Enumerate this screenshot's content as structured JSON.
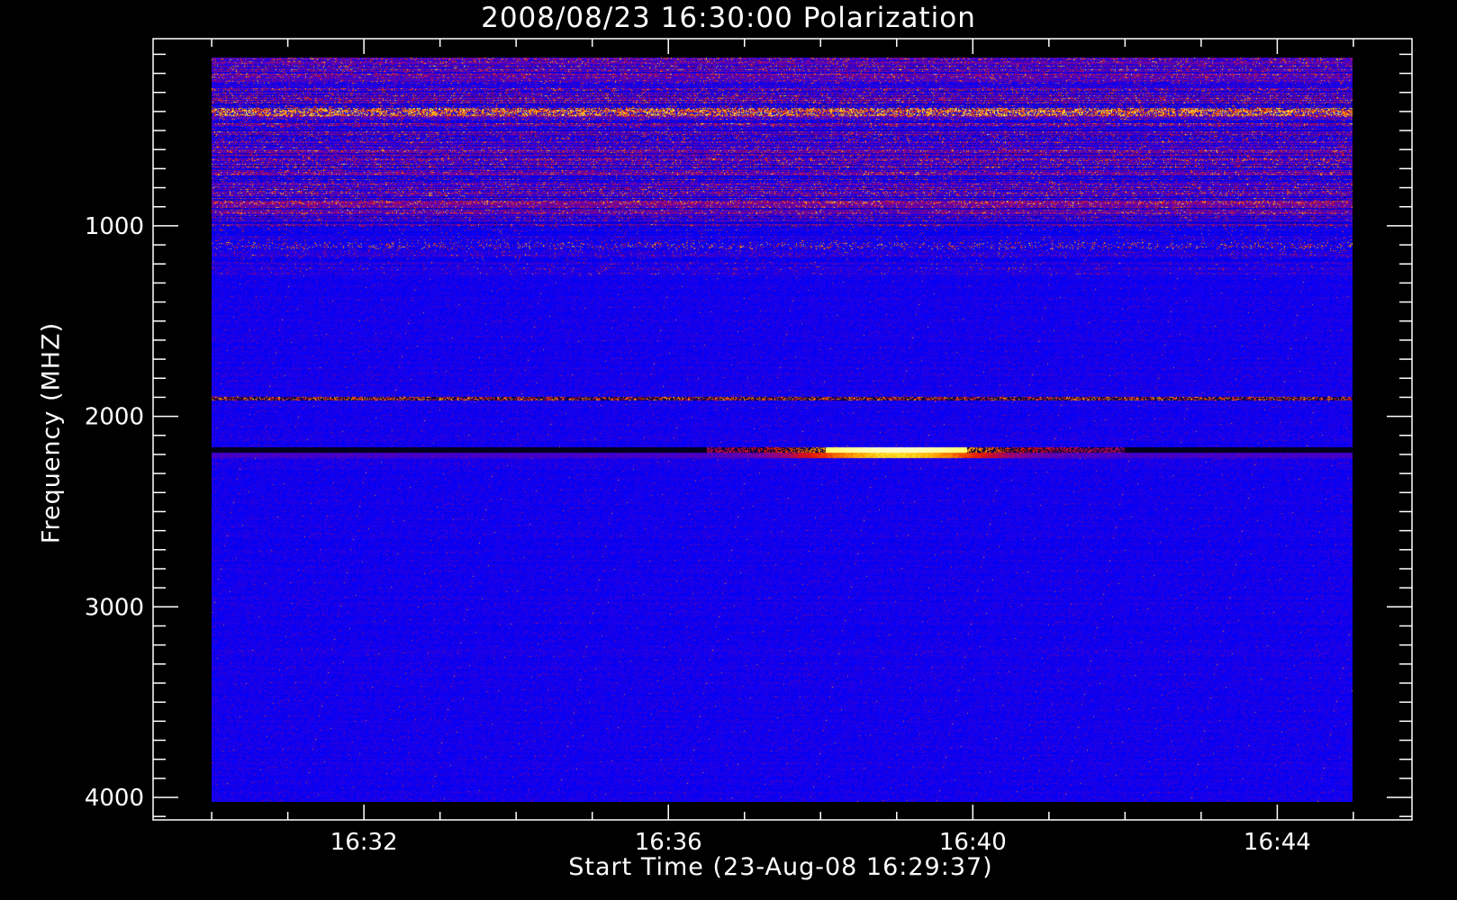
{
  "chart_data": {
    "type": "heatmap",
    "title": "2008/08/23 16:30:00 Polarization",
    "xlabel": "Start Time (23-Aug-08 16:29:37)",
    "ylabel": "Frequency (MHZ)",
    "xlim_minutes": [
      989.23,
      1005.77
    ],
    "data_x_range_minutes": [
      990,
      1005
    ],
    "ylim": [
      18,
      4118
    ],
    "data_y_range": [
      117,
      4020
    ],
    "y_inverted": true,
    "x_ticks": [
      {
        "minutes": 992,
        "label": "16:32"
      },
      {
        "minutes": 996,
        "label": "16:36"
      },
      {
        "minutes": 1000,
        "label": "16:40"
      },
      {
        "minutes": 1004,
        "label": "16:44"
      }
    ],
    "x_minor_step_minutes": 1,
    "y_ticks": [
      {
        "value": 1000,
        "label": "1000"
      },
      {
        "value": 2000,
        "label": "2000"
      },
      {
        "value": 3000,
        "label": "3000"
      },
      {
        "value": 4000,
        "label": "4000"
      }
    ],
    "y_minor_step": 100,
    "colormap": [
      "#000000",
      "#0000c8",
      "#0000ff",
      "#8c008c",
      "#e61400",
      "#ffa000",
      "#ffff3c",
      "#ffffff"
    ],
    "features": [
      {
        "name": "rfi-noisy-low-band",
        "f": [
          117,
          1000
        ],
        "t": [
          990,
          1005
        ],
        "level": 0.45
      },
      {
        "name": "rfi-band-400",
        "f": [
          380,
          420
        ],
        "t": [
          990,
          1005
        ],
        "level": 0.8
      },
      {
        "name": "rfi-sparse-1100",
        "f": [
          1080,
          1120
        ],
        "t": [
          990,
          1005
        ],
        "level": 0.6
      },
      {
        "name": "band-1900",
        "f": [
          1895,
          1915
        ],
        "t": [
          990,
          1005
        ],
        "level": 0.55
      },
      {
        "name": "gap-2160",
        "f": [
          2160,
          2185
        ],
        "t": [
          990,
          1005
        ],
        "level": 0.0
      },
      {
        "name": "burst-2180",
        "f": [
          2160,
          2215
        ],
        "t": [
          996.5,
          1002
        ],
        "level": 0.95,
        "peak_minutes": 999
      }
    ]
  }
}
